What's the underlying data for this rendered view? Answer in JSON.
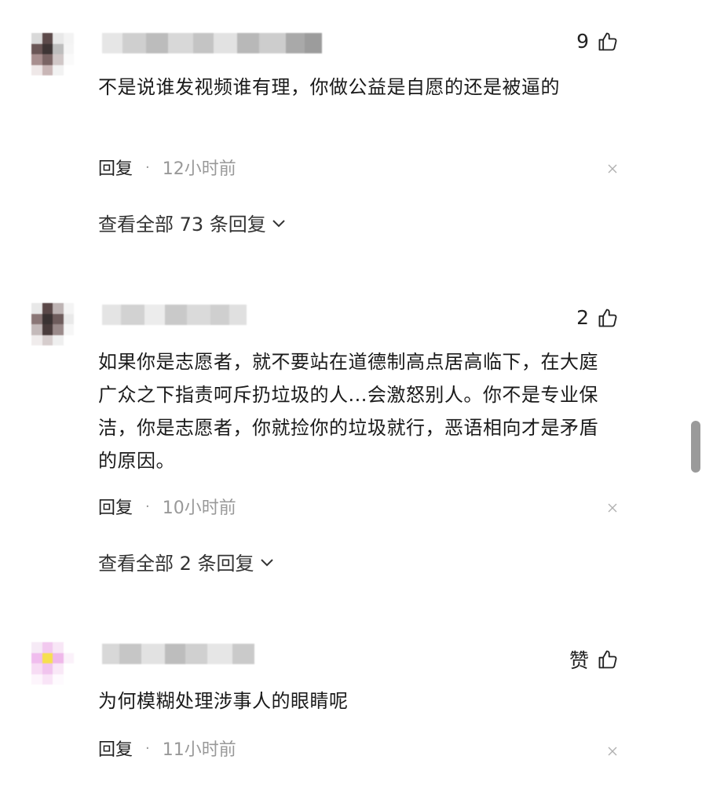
{
  "comments": [
    {
      "like_count": "9",
      "text": "不是说谁发视频谁有理，你做公益是自愿的还是被逼的",
      "reply_label": "回复",
      "separator": "·",
      "time": "12小时前",
      "view_all": "查看全部 73 条回复"
    },
    {
      "like_count": "2",
      "text": "如果你是志愿者，就不要站在道德制高点居高临下，在大庭广众之下指责呵斥扔垃圾的人...会激怒别人。你不是专业保洁，你是志愿者，你就捡你的垃圾就行，恶语相向才是矛盾的原因。",
      "reply_label": "回复",
      "separator": "·",
      "time": "10小时前",
      "view_all": "查看全部 2 条回复"
    },
    {
      "like_count": "赞",
      "text": "为何模糊处理涉事人的眼睛呢",
      "reply_label": "回复",
      "separator": "·",
      "time": "11小时前"
    }
  ],
  "icons": {
    "like": "thumbs-up-icon",
    "close": "close-icon",
    "expand": "chevron-down-icon"
  },
  "colors": {
    "text": "#1a1a1a",
    "muted": "#999999",
    "scrollbar": "#9a9a9a"
  }
}
